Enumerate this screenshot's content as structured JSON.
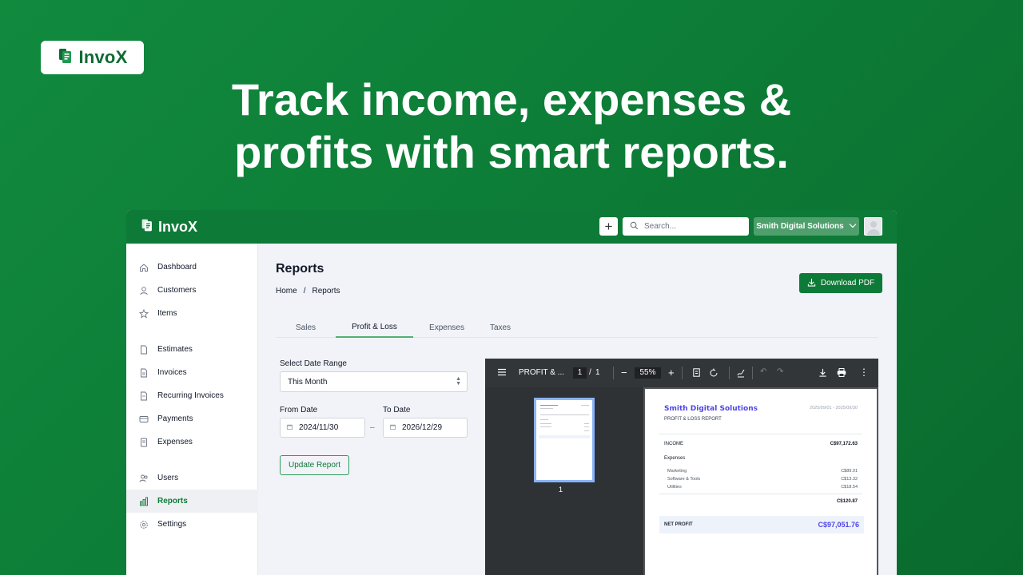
{
  "brand": {
    "name": "InvoX"
  },
  "headline": {
    "line1": "Track income, expenses &",
    "line2": "profits with smart reports."
  },
  "app": {
    "logo_name": "InvoX",
    "search_placeholder": "Search...",
    "company": "Smith Digital Solutions",
    "accent": "#0e7a37"
  },
  "sidebar": {
    "items": [
      {
        "label": "Dashboard",
        "icon": "home-icon"
      },
      {
        "label": "Customers",
        "icon": "user-icon"
      },
      {
        "label": "Items",
        "icon": "star-icon"
      },
      {
        "label": "Estimates",
        "icon": "document-icon"
      },
      {
        "label": "Invoices",
        "icon": "document-icon"
      },
      {
        "label": "Recurring Invoices",
        "icon": "document-icon"
      },
      {
        "label": "Payments",
        "icon": "credit-card-icon"
      },
      {
        "label": "Expenses",
        "icon": "receipt-icon"
      },
      {
        "label": "Users",
        "icon": "users-icon"
      },
      {
        "label": "Reports",
        "icon": "chart-icon",
        "active": true
      },
      {
        "label": "Settings",
        "icon": "gear-icon"
      }
    ]
  },
  "page": {
    "title": "Reports",
    "breadcrumb": {
      "home": "Home",
      "sep": "/",
      "current": "Reports"
    },
    "download_label": "Download PDF"
  },
  "tabs": [
    {
      "label": "Sales"
    },
    {
      "label": "Profit & Loss",
      "active": true
    },
    {
      "label": "Expenses"
    },
    {
      "label": "Taxes"
    }
  ],
  "form": {
    "date_range_label": "Select Date Range",
    "date_range_value": "This Month",
    "from_label": "From Date",
    "from_value": "2024/11/30",
    "to_label": "To Date",
    "to_value": "2026/12/29",
    "date_sep": "–",
    "update_label": "Update Report"
  },
  "pdf": {
    "title": "PROFIT & ...",
    "page_current": "1",
    "page_sep": "/",
    "page_total": "1",
    "zoom": "55%",
    "thumb_number": "1",
    "doc": {
      "company": "Smith Digital Solutions",
      "dates": "2025/09/01 - 2025/09/30",
      "subtitle": "PROFIT & LOSS REPORT",
      "income_label": "INCOME",
      "income_value": "C$97,172.63",
      "expenses_label": "Expenses",
      "expense_items": [
        {
          "label": "Marketing",
          "value": "C$89.01"
        },
        {
          "label": "Software & Tools",
          "value": "C$13.32"
        },
        {
          "label": "Utilities",
          "value": "C$18.54"
        }
      ],
      "expenses_total": "C$120.87",
      "net_label": "NET PROFIT",
      "net_value": "C$97,051.76"
    }
  }
}
